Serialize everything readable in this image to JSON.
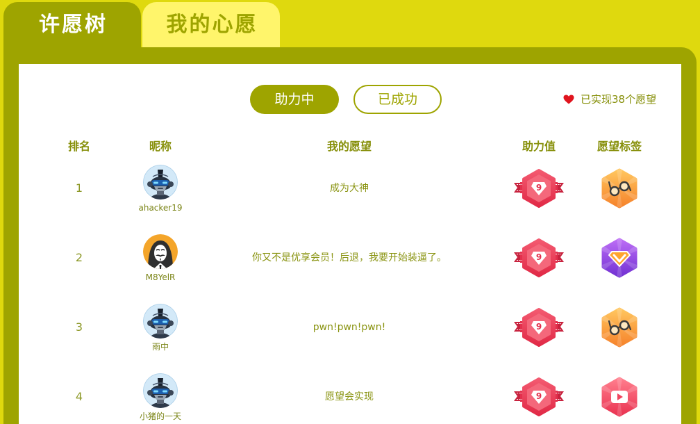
{
  "tabs": [
    {
      "label": "许愿树",
      "active": true
    },
    {
      "label": "我的心愿",
      "active": false
    }
  ],
  "filters": [
    {
      "label": "助力中",
      "selected": true
    },
    {
      "label": "已成功",
      "selected": false
    }
  ],
  "achieved": {
    "icon": "heart-icon",
    "text": "已实现38个愿望"
  },
  "table": {
    "headers": {
      "rank": "排名",
      "nickname": "昵称",
      "wish": "我的愿望",
      "boost": "助力值",
      "tag": "愿望标签"
    },
    "rows": [
      {
        "rank": "1",
        "avatar_icon": "robot-helmet-icon",
        "nickname": "ahacker19",
        "wish": "成为大神",
        "boost": "9",
        "tag_icon": "glasses-icon"
      },
      {
        "rank": "2",
        "avatar_icon": "anonymous-mask-icon",
        "nickname": "M8YelR",
        "wish": "你又不是优享会员！后退，我要开始装逼了。",
        "boost": "9",
        "tag_icon": "vip-diamond-icon"
      },
      {
        "rank": "3",
        "avatar_icon": "robot-helmet-icon",
        "nickname": "雨中",
        "wish": "pwn!pwn!pwn!",
        "boost": "9",
        "tag_icon": "glasses-icon"
      },
      {
        "rank": "4",
        "avatar_icon": "robot-helmet-icon",
        "nickname": "小猪的一天",
        "wish": "愿望会实现",
        "boost": "9",
        "tag_icon": "play-icon"
      }
    ]
  },
  "colors": {
    "page_background": "#dfd90e",
    "accent_olive": "#9ea400",
    "tab_light": "#fff56b",
    "text_olive": "#87900b",
    "heart_red": "#e0141e"
  }
}
